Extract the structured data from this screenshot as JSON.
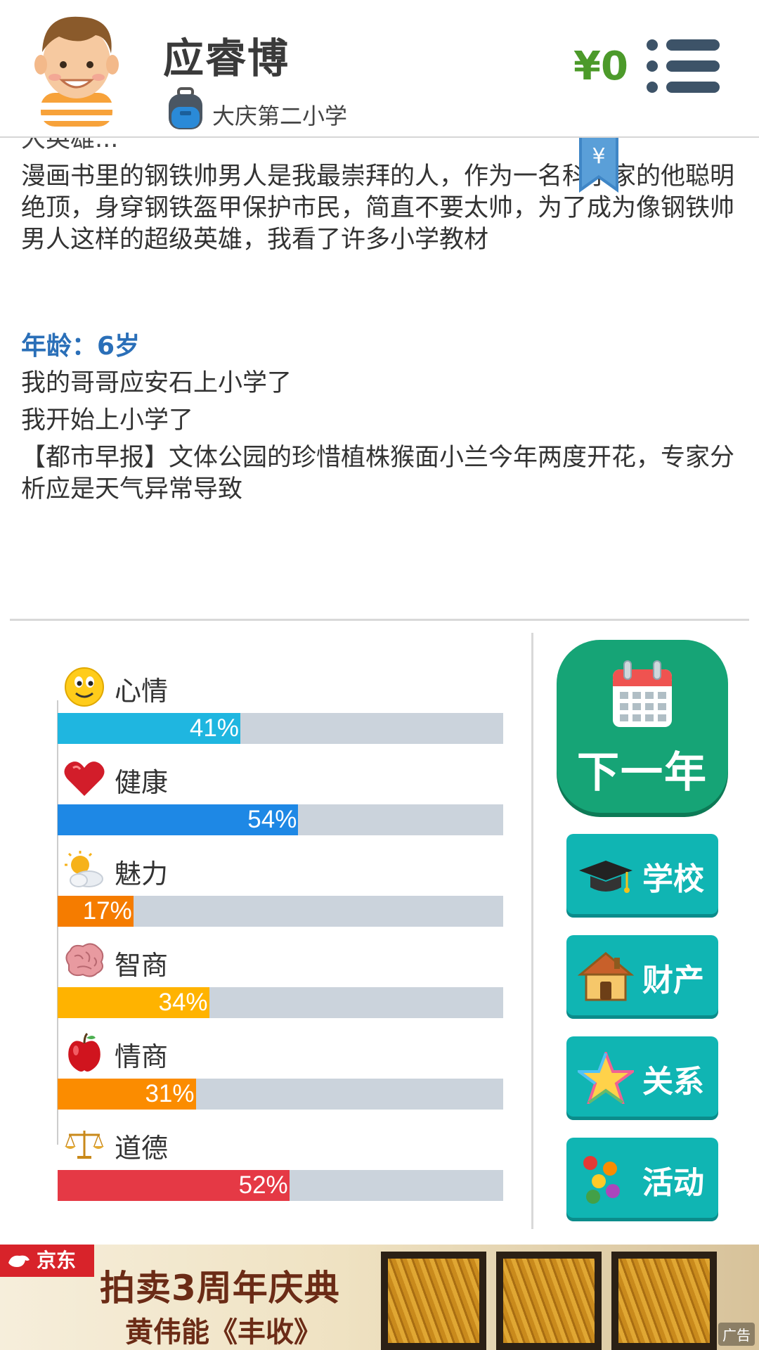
{
  "header": {
    "player_name": "应睿博",
    "school": "大庆第二小学",
    "money": "¥0",
    "avatar_icon": "boy-avatar-icon",
    "school_icon": "backpack-icon",
    "menu_icon": "menu-icon"
  },
  "bookmark": {
    "symbol": "¥"
  },
  "log": {
    "clipped_line": "大英雄...",
    "paragraph": "漫画书里的钢铁帅男人是我最崇拜的人，作为一名科学家的他聪明绝顶，身穿钢铁盔甲保护市民，简直不要太帅，为了成为像钢铁帅男人这样的超级英雄，我看了许多小学教材",
    "age_heading": "年龄：6岁",
    "entries": [
      "我的哥哥应安石上小学了",
      "我开始上小学了",
      "【都市早报】文体公园的珍惜植株猴面小兰今年两度开花，专家分析应是天气异常导致"
    ]
  },
  "stats": [
    {
      "label": "心情",
      "value": 41,
      "pct": "41%",
      "color": "#1fb6e0",
      "icon": "smiley-face-icon"
    },
    {
      "label": "健康",
      "value": 54,
      "pct": "54%",
      "color": "#1e88e5",
      "icon": "heart-icon"
    },
    {
      "label": "魅力",
      "value": 17,
      "pct": "17%",
      "color": "#f57c00",
      "icon": "sun-cloud-icon"
    },
    {
      "label": "智商",
      "value": 34,
      "pct": "34%",
      "color": "#ffb300",
      "icon": "brain-icon"
    },
    {
      "label": "情商",
      "value": 31,
      "pct": "31%",
      "color": "#fb8c00",
      "icon": "apple-icon"
    },
    {
      "label": "道德",
      "value": 52,
      "pct": "52%",
      "color": "#e53945",
      "icon": "scales-icon"
    }
  ],
  "actions": {
    "next_year": "下一年",
    "school": "学校",
    "property": "财产",
    "relations": "关系",
    "activities": "活动"
  },
  "ad": {
    "brand": "京东",
    "headline": "拍卖3周年庆典",
    "subline": "黄伟能《丰收》",
    "tag": "广告"
  }
}
